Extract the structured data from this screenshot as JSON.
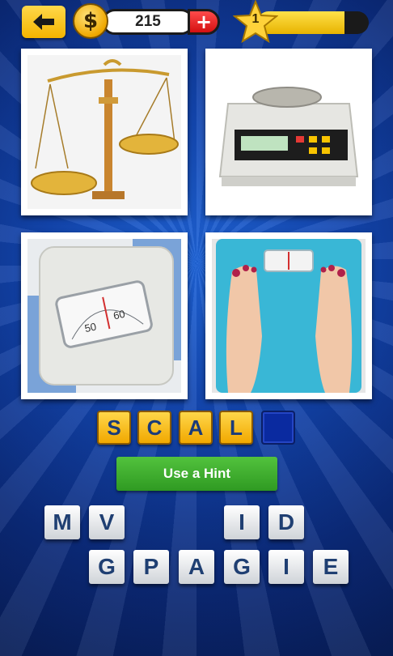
{
  "header": {
    "back_icon": "arrow-left-icon",
    "coin_symbol": "$",
    "coins": "215",
    "buy_coins_symbol": "+",
    "level": "1",
    "level_progress": 0.78
  },
  "pictures": [
    {
      "subject": "balance scale"
    },
    {
      "subject": "digital scale"
    },
    {
      "subject": "bathroom scale"
    },
    {
      "subject": "feet on scale"
    }
  ],
  "answer": {
    "letters": [
      "S",
      "C",
      "A",
      "L",
      ""
    ]
  },
  "hint": {
    "label": "Use a Hint"
  },
  "keyboard": {
    "row1": [
      "M",
      "V",
      "",
      "",
      "I",
      "D"
    ],
    "row2": [
      "G",
      "P",
      "A",
      "G",
      "I",
      "E"
    ]
  }
}
